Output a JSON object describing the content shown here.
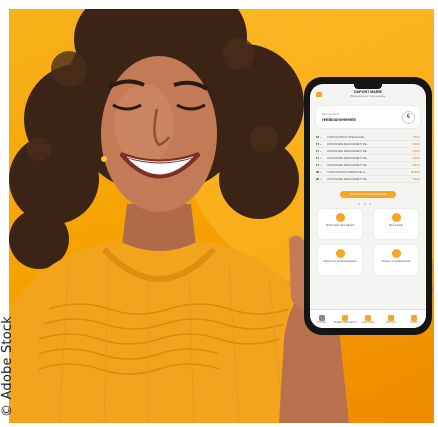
{
  "watermark": "© Adobe Stock",
  "colors": {
    "background": "#f6a300",
    "accent": "#f5a623",
    "shirt": "#f2a51c"
  },
  "app": {
    "title": "DUPONT MARIE",
    "subtitle": "Bienvenue sur votre espace",
    "badge": "",
    "card": {
      "label": "Mes derniers",
      "value": "remboursements"
    },
    "euro_icon": "€",
    "transactions": [
      {
        "date": "18 ...",
        "label": "CONSULTATION SPECIALISE...",
        "amount": "7,50 €"
      },
      {
        "date": "17 ...",
        "label": "HONORAIRE MEDICAMENT RE...",
        "amount": "8,01 €"
      },
      {
        "date": "17 ...",
        "label": "HONORAIRE MEDICAMENT RE...",
        "amount": "2,52 €"
      },
      {
        "date": "17 ...",
        "label": "HONORAIRE MEDICAMENT RE...",
        "amount": "3,22 €"
      },
      {
        "date": "17 ...",
        "label": "HONORAIRE MEDICAMENT RE...",
        "amount": "2,51 €"
      },
      {
        "date": "09 ...",
        "label": "CONSULTATION MEDECINE G...",
        "amount": "25,50 €"
      },
      {
        "date": "28 ...",
        "label": "HONORAIRE MEDICAMENT RE...",
        "amount": "7,04 €"
      }
    ],
    "cta": "Voir tous mes remboursements",
    "tiles": [
      {
        "label": "Wi-Fi Carte Tiers Payant"
      },
      {
        "label": "Mon contrat"
      },
      {
        "label": "Suivre mes remboursements"
      },
      {
        "label": "Trouver un professionnel"
      }
    ],
    "tabs": [
      {
        "label": "ACCUEIL"
      },
      {
        "label": "REMBOURSEMENTS"
      },
      {
        "label": "GARANTIES"
      },
      {
        "label": "CONTACT"
      },
      {
        "label": "PROFIL"
      }
    ]
  }
}
